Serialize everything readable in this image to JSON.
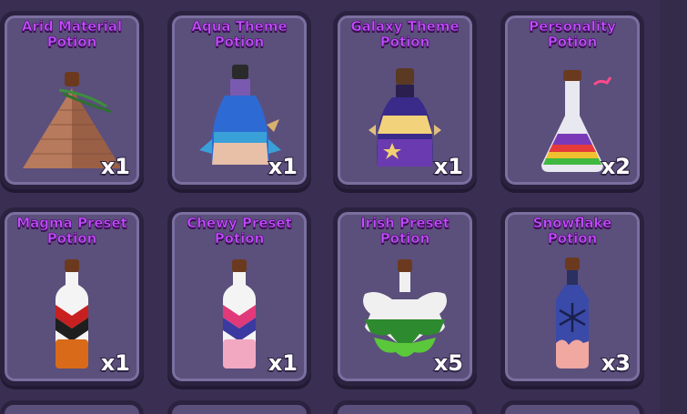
{
  "inventory": {
    "items": [
      {
        "title": "Arid Material Potion",
        "count": "x1",
        "icon": "arid-material-potion-icon"
      },
      {
        "title": "Aqua Theme Potion",
        "count": "x1",
        "icon": "aqua-theme-potion-icon"
      },
      {
        "title": "Galaxy Theme Potion",
        "count": "x1",
        "icon": "galaxy-theme-potion-icon"
      },
      {
        "title": "Personality Potion",
        "count": "x2",
        "icon": "personality-potion-icon"
      },
      {
        "title": "Magma Preset Potion",
        "count": "x1",
        "icon": "magma-preset-potion-icon"
      },
      {
        "title": "Chewy Preset Potion",
        "count": "x1",
        "icon": "chewy-preset-potion-icon"
      },
      {
        "title": "Irish Preset Potion",
        "count": "x5",
        "icon": "irish-preset-potion-icon"
      },
      {
        "title": "Snowflake Potion",
        "count": "x3",
        "icon": "snowflake-potion-icon"
      }
    ]
  },
  "colors": {
    "background": "#3a2f52",
    "card": "#5b4f7c",
    "title": "#c44dff"
  }
}
